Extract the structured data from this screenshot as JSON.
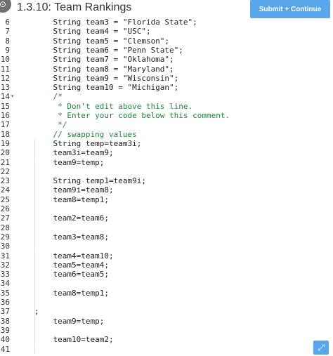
{
  "header": {
    "logo_glyph": "⊙",
    "title": "1.3.10: Team Rankings",
    "submit_label": "Submit + Continue"
  },
  "editor": {
    "lines": [
      {
        "n": "6",
        "fold": "",
        "code": "    String team3 = \"Florida State\";",
        "color": "#222222"
      },
      {
        "n": "7",
        "fold": "",
        "code": "    String team4 = \"USC\";",
        "color": "#222222"
      },
      {
        "n": "8",
        "fold": "",
        "code": "    String team5 = \"Clemson\";",
        "color": "#222222"
      },
      {
        "n": "9",
        "fold": "",
        "code": "    String team6 = \"Penn State\";",
        "color": "#222222"
      },
      {
        "n": "10",
        "fold": "",
        "code": "    String team7 = \"Oklahoma\";",
        "color": "#222222"
      },
      {
        "n": "11",
        "fold": "",
        "code": "    String team8 = \"Maryland\";",
        "color": "#222222"
      },
      {
        "n": "12",
        "fold": "",
        "code": "    String team9 = \"Wisconsin\";",
        "color": "#222222"
      },
      {
        "n": "13",
        "fold": "",
        "code": "    String team10 = \"Michigan\";",
        "color": "#222222"
      },
      {
        "n": "14",
        "fold": "▾",
        "code": "    /*",
        "color": "#22863a"
      },
      {
        "n": "15",
        "fold": "",
        "code": "     * Don't edit above this line.",
        "color": "#22863a"
      },
      {
        "n": "16",
        "fold": "",
        "code": "     * Enter your code below this comment.",
        "color": "#22863a"
      },
      {
        "n": "17",
        "fold": "",
        "code": "     */",
        "color": "#22863a"
      },
      {
        "n": "18",
        "fold": "",
        "code": "    // swapping values",
        "color": "#22863a"
      },
      {
        "n": "19",
        "fold": "",
        "code": "    String temp=team3i;",
        "color": "#222222"
      },
      {
        "n": "20",
        "fold": "",
        "code": "    team3i=team9;",
        "color": "#222222"
      },
      {
        "n": "21",
        "fold": "",
        "code": "    team9=temp;",
        "color": "#222222"
      },
      {
        "n": "22",
        "fold": "",
        "code": "",
        "color": "#222222"
      },
      {
        "n": "23",
        "fold": "",
        "code": "    String temp1=team9i;",
        "color": "#222222"
      },
      {
        "n": "24",
        "fold": "",
        "code": "    team9i=team8;",
        "color": "#222222"
      },
      {
        "n": "25",
        "fold": "",
        "code": "    team8=temp1;",
        "color": "#222222"
      },
      {
        "n": "26",
        "fold": "",
        "code": "",
        "color": "#222222"
      },
      {
        "n": "27",
        "fold": "",
        "code": "    team2=team6;",
        "color": "#222222"
      },
      {
        "n": "28",
        "fold": "",
        "code": "",
        "color": "#222222"
      },
      {
        "n": "29",
        "fold": "",
        "code": "    team3=team8;",
        "color": "#222222"
      },
      {
        "n": "30",
        "fold": "",
        "code": "",
        "color": "#222222"
      },
      {
        "n": "31",
        "fold": "",
        "code": "    team4=team10;",
        "color": "#222222"
      },
      {
        "n": "32",
        "fold": "",
        "code": "    team5=team4;",
        "color": "#222222"
      },
      {
        "n": "33",
        "fold": "",
        "code": "    team6=team5;",
        "color": "#222222"
      },
      {
        "n": "34",
        "fold": "",
        "code": "",
        "color": "#222222"
      },
      {
        "n": "35",
        "fold": "",
        "code": "    team8=temp1;",
        "color": "#222222"
      },
      {
        "n": "36",
        "fold": "",
        "code": "",
        "color": "#222222"
      },
      {
        "n": "37",
        "fold": "",
        "code": ";",
        "color": "#222222"
      },
      {
        "n": "38",
        "fold": "",
        "code": "    team9=temp;",
        "color": "#222222"
      },
      {
        "n": "39",
        "fold": "",
        "code": "",
        "color": "#222222"
      },
      {
        "n": "40",
        "fold": "",
        "code": "    team10=team2;",
        "color": "#222222"
      },
      {
        "n": "41",
        "fold": "",
        "code": "",
        "color": "#222222"
      }
    ]
  },
  "expand_icon": "⤢",
  "colors": {
    "accent": "#5aa6ea",
    "comment": "#22863a",
    "text": "#222222"
  }
}
